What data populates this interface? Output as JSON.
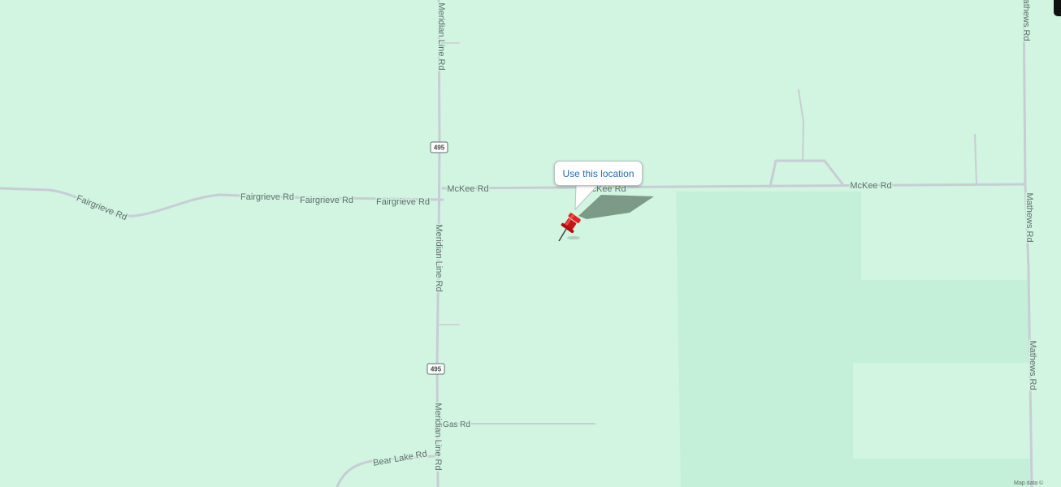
{
  "map": {
    "colors": {
      "land": "#d1f5e1",
      "field": "#c4efd8",
      "road": "#c9ccd6",
      "label": "#5f6b6e"
    },
    "road_labels": {
      "meridian_1": "Meridian Line Rd",
      "meridian_2": "Meridian Line Rd",
      "meridian_3": "Meridian Line Rd",
      "mckee_1": "McKee Rd",
      "mckee_2": "McKee Rd",
      "mckee_3": "McKee Rd",
      "fairgrieve_1": "Fairgrieve Rd",
      "fairgrieve_2": "Fairgrieve Rd",
      "fairgrieve_3": "Fairgrieve Rd",
      "fairgrieve_4": "Fairgrieve Rd",
      "mathews_1": "Mathews Rd",
      "mathews_2": "Mathews Rd",
      "mathews_3": "Mathews Rd",
      "gas": "Gas Rd",
      "bear_lake": "Bear Lake Rd"
    },
    "route_shields": {
      "r495_1": "495",
      "r495_2": "495"
    },
    "attribution": "Map data ©"
  },
  "callout": {
    "text": "Use this location"
  },
  "marker": {
    "icon": "red-pushpin-icon",
    "color": "#d41a1a"
  }
}
